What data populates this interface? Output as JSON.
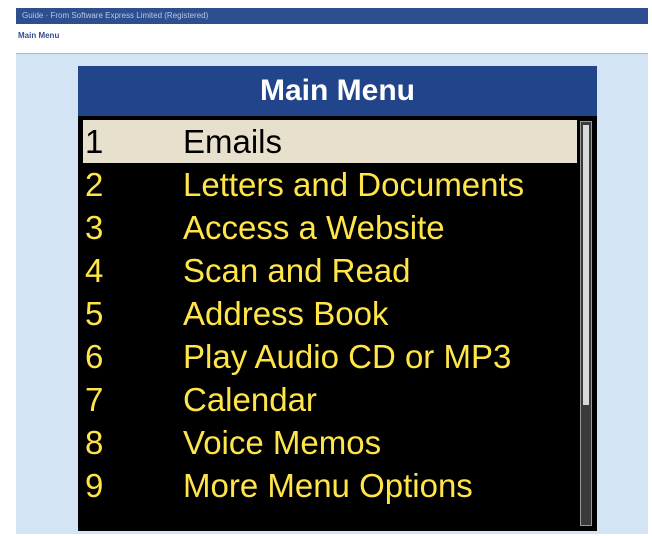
{
  "window": {
    "title": "Guide  ·  From Software Express Limited (Registered)",
    "breadcrumb": "Main Menu"
  },
  "menu": {
    "title": "Main Menu",
    "selected_index": 0,
    "items": [
      {
        "number": "1",
        "label": "Emails"
      },
      {
        "number": "2",
        "label": "Letters and Documents"
      },
      {
        "number": "3",
        "label": "Access a Website"
      },
      {
        "number": "4",
        "label": "Scan and Read"
      },
      {
        "number": "5",
        "label": "Address Book"
      },
      {
        "number": "6",
        "label": "Play Audio CD or MP3"
      },
      {
        "number": "7",
        "label": "Calendar"
      },
      {
        "number": "8",
        "label": "Voice Memos"
      },
      {
        "number": "9",
        "label": "More Menu Options"
      }
    ]
  },
  "colors": {
    "header_bg": "#21448a",
    "panel_bg": "#000000",
    "item_text": "#ffe54a",
    "selected_bg": "#e6e0cc",
    "app_bg": "#d3e4f5"
  }
}
